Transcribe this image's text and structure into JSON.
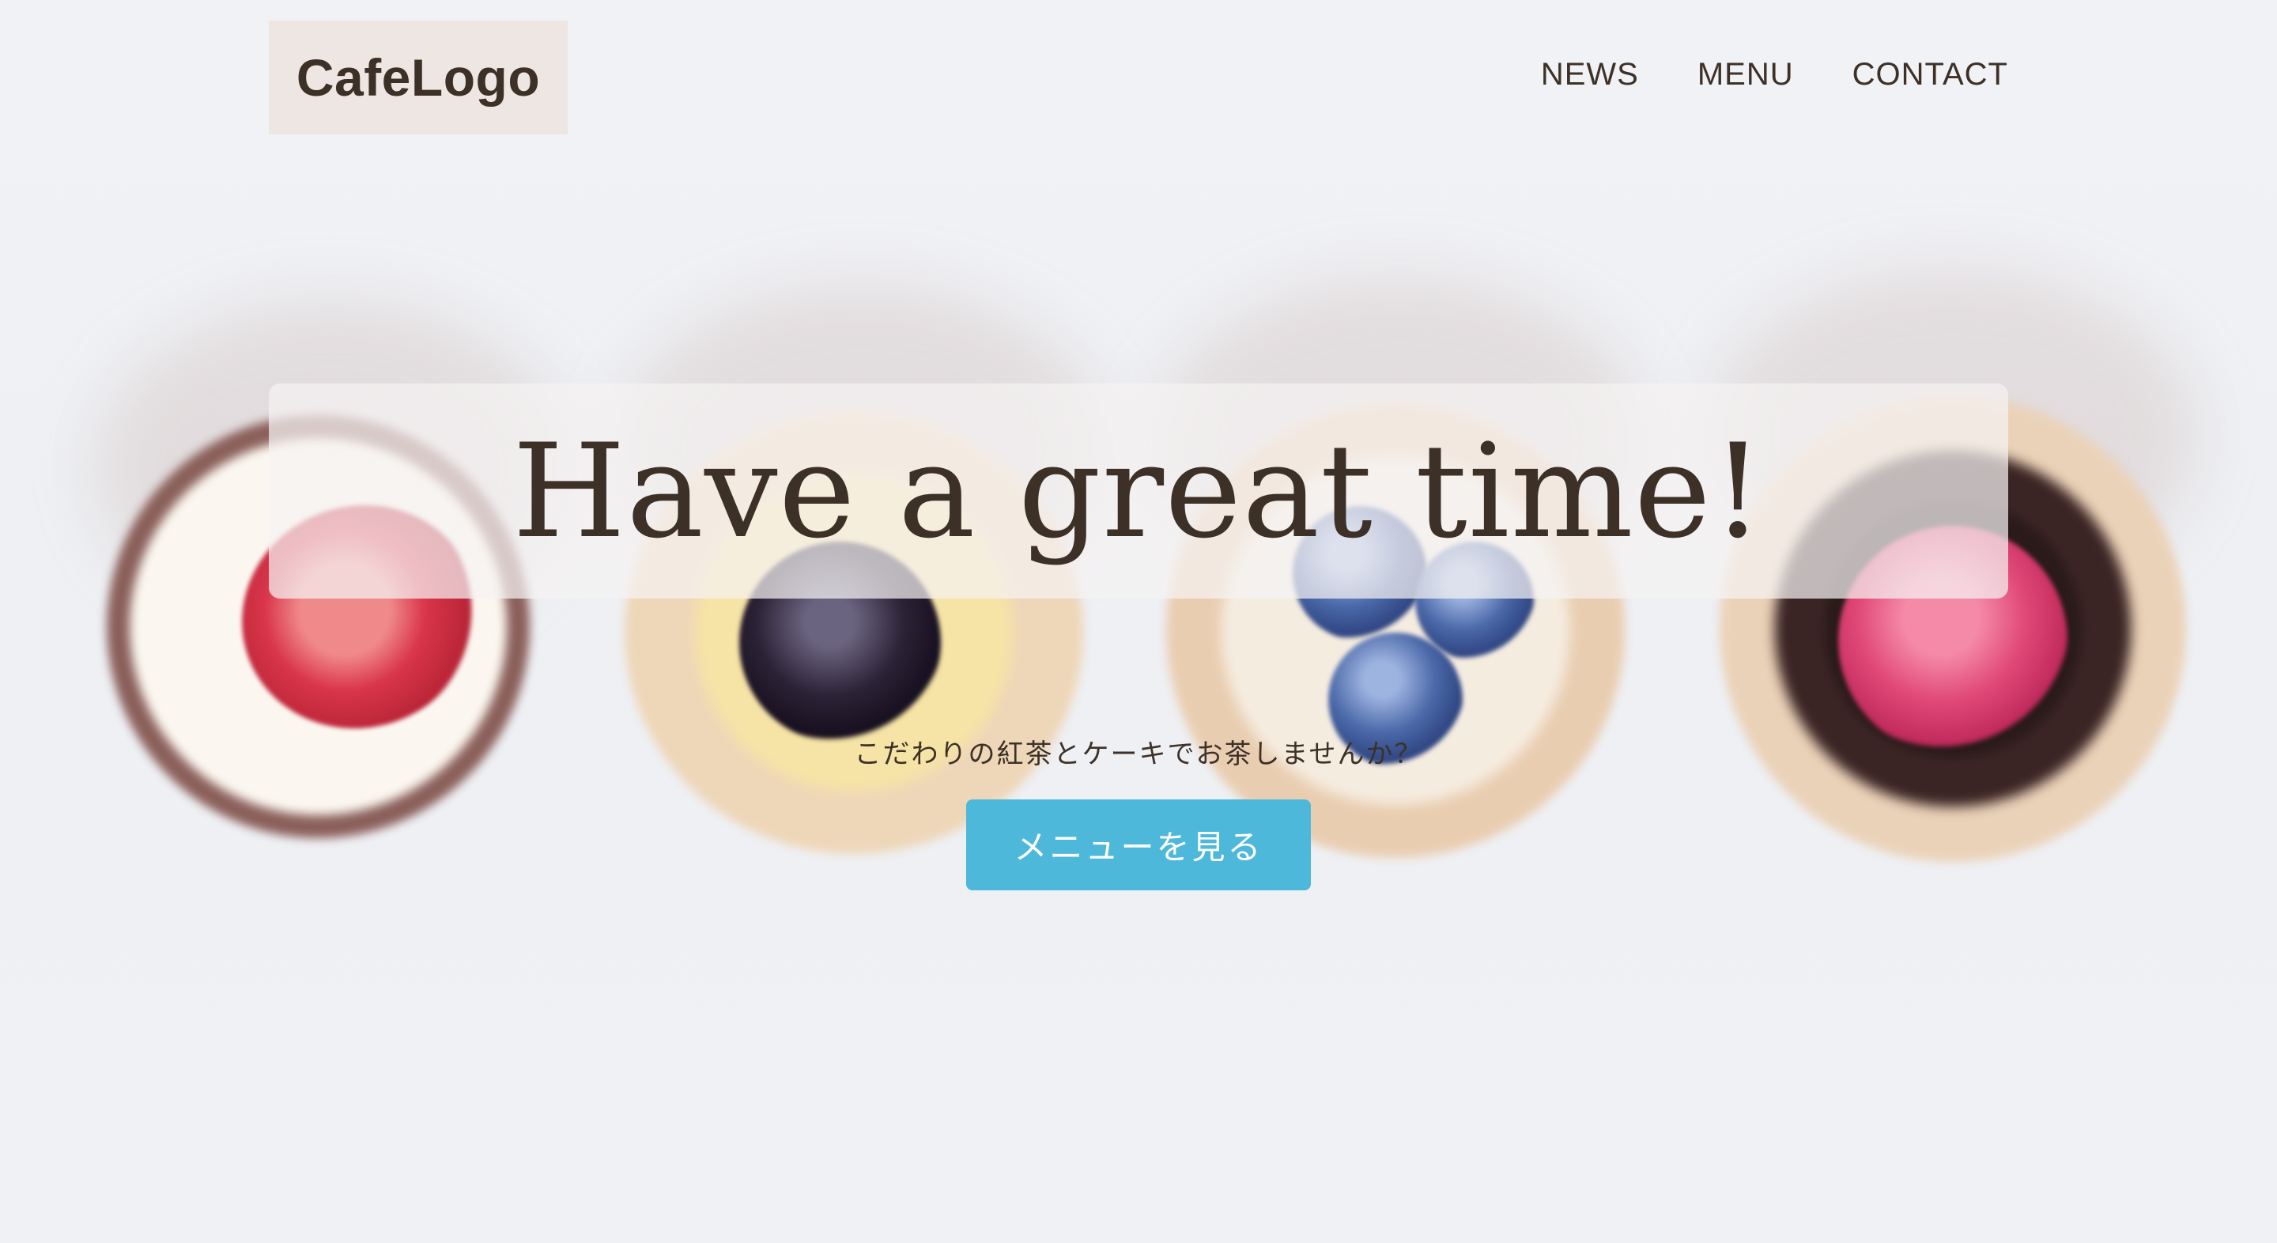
{
  "header": {
    "logo": "CafeLogo",
    "nav": [
      {
        "label": "NEWS"
      },
      {
        "label": "MENU"
      },
      {
        "label": "CONTACT"
      }
    ]
  },
  "hero": {
    "headline": "Have a great time!",
    "tagline": "こだわりの紅茶とケーキでお茶しませんか？",
    "cta_label": "メニューを見る"
  },
  "colors": {
    "text": "#3d3127",
    "accent": "#4db8d9",
    "logo_bg": "#ece4e0",
    "background": "#eef0f4"
  }
}
